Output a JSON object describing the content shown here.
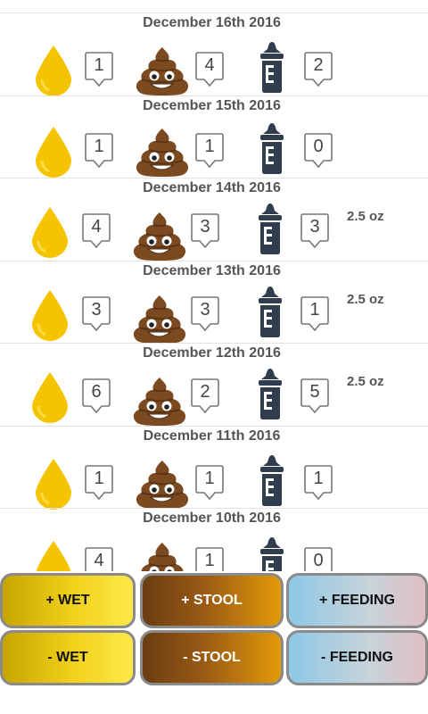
{
  "colors": {
    "drop": "#f5c400",
    "stool": "#7b4a21",
    "bottle": "#2f3d4e",
    "wet_gradient": [
      "#c8a400",
      "#fde94a"
    ],
    "stool_gradient": [
      "#6b3d12",
      "#e39a08"
    ],
    "feeding_gradient": [
      "#8cc9e6",
      "#e0bec3"
    ]
  },
  "icons": {
    "wet": "wet-drop-icon",
    "stool": "stool-emoji-icon",
    "feeding": "baby-bottle-icon"
  },
  "days": [
    {
      "date": "December 16th 2016",
      "wet": "1",
      "stool": "4",
      "feeding": "2",
      "amount": ""
    },
    {
      "date": "December 15th 2016",
      "wet": "1",
      "stool": "1",
      "feeding": "0",
      "amount": ""
    },
    {
      "date": "December 14th 2016",
      "wet": "4",
      "stool": "3",
      "feeding": "3",
      "amount": "2.5 oz"
    },
    {
      "date": "December 13th 2016",
      "wet": "3",
      "stool": "3",
      "feeding": "1",
      "amount": "2.5 oz"
    },
    {
      "date": "December 12th 2016",
      "wet": "6",
      "stool": "2",
      "feeding": "5",
      "amount": "2.5 oz"
    },
    {
      "date": "December 11th 2016",
      "wet": "1",
      "stool": "1",
      "feeding": "1",
      "amount": ""
    },
    {
      "date": "December 10th 2016",
      "wet": "4",
      "stool": "1",
      "feeding": "0",
      "amount": ""
    }
  ],
  "buttons": {
    "add_wet": "+ WET",
    "add_stool": "+ STOOL",
    "add_feeding": "+ FEEDING",
    "remove_wet": "- WET",
    "remove_stool": "- STOOL",
    "remove_feeding": "- FEEDING"
  }
}
